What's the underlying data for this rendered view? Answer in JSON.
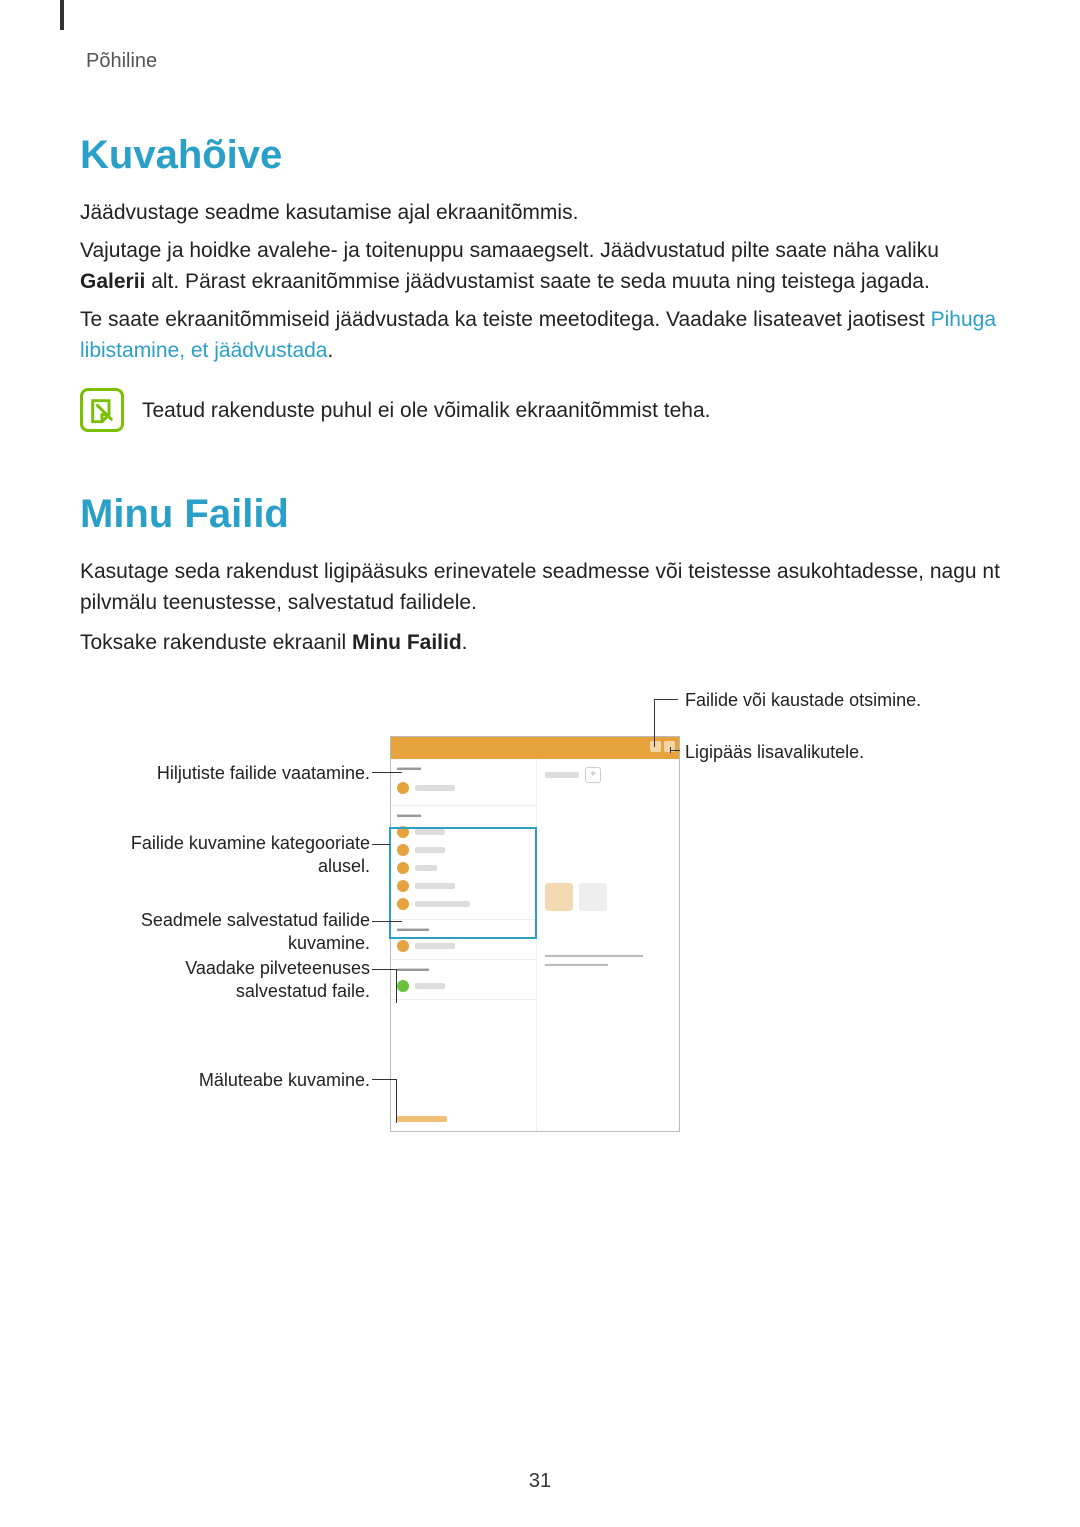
{
  "breadcrumb": "Põhiline",
  "section1": {
    "title": "Kuvahõive",
    "p1": "Jäädvustage seadme kasutamise ajal ekraanitõmmis.",
    "p2a": "Vajutage ja hoidke avalehe- ja toitenuppu samaaegselt. Jäädvustatud pilte saate näha valiku ",
    "p2b_bold": "Galerii",
    "p2c": " alt. Pärast ekraanitõmmise jäädvustamist saate te seda muuta ning teistega jagada.",
    "p3a": "Te saate ekraanitõmmiseid jäädvustada ka teiste meetoditega. Vaadake lisateavet jaotisest ",
    "p3_link": "Pihuga libistamine, et jäädvustada",
    "p3b": ".",
    "note": "Teatud rakenduste puhul ei ole võimalik ekraanitõmmist teha."
  },
  "section2": {
    "title": "Minu Failid",
    "p1": "Kasutage seda rakendust ligipääsuks erinevatele seadmesse või teistesse asukohtadesse, nagu nt pilvmälu teenustesse, salvestatud failidele.",
    "p2a": "Toksake rakenduste ekraanil ",
    "p2b_bold": "Minu Failid",
    "p2c": "."
  },
  "callouts": {
    "search": "Failide või kaustade otsimine.",
    "options": "Ligipääs lisavalikutele.",
    "recent": "Hiljutiste failide vaatamine.",
    "categories": "Failide kuvamine kategooriate alusel.",
    "local": "Seadmele salvestatud failide kuvamine.",
    "cloud": "Vaadake pilveteenuses salvestatud faile.",
    "storage": "Mäluteabe kuvamine."
  },
  "page_number": "31",
  "icons": {
    "note": "note-icon"
  }
}
